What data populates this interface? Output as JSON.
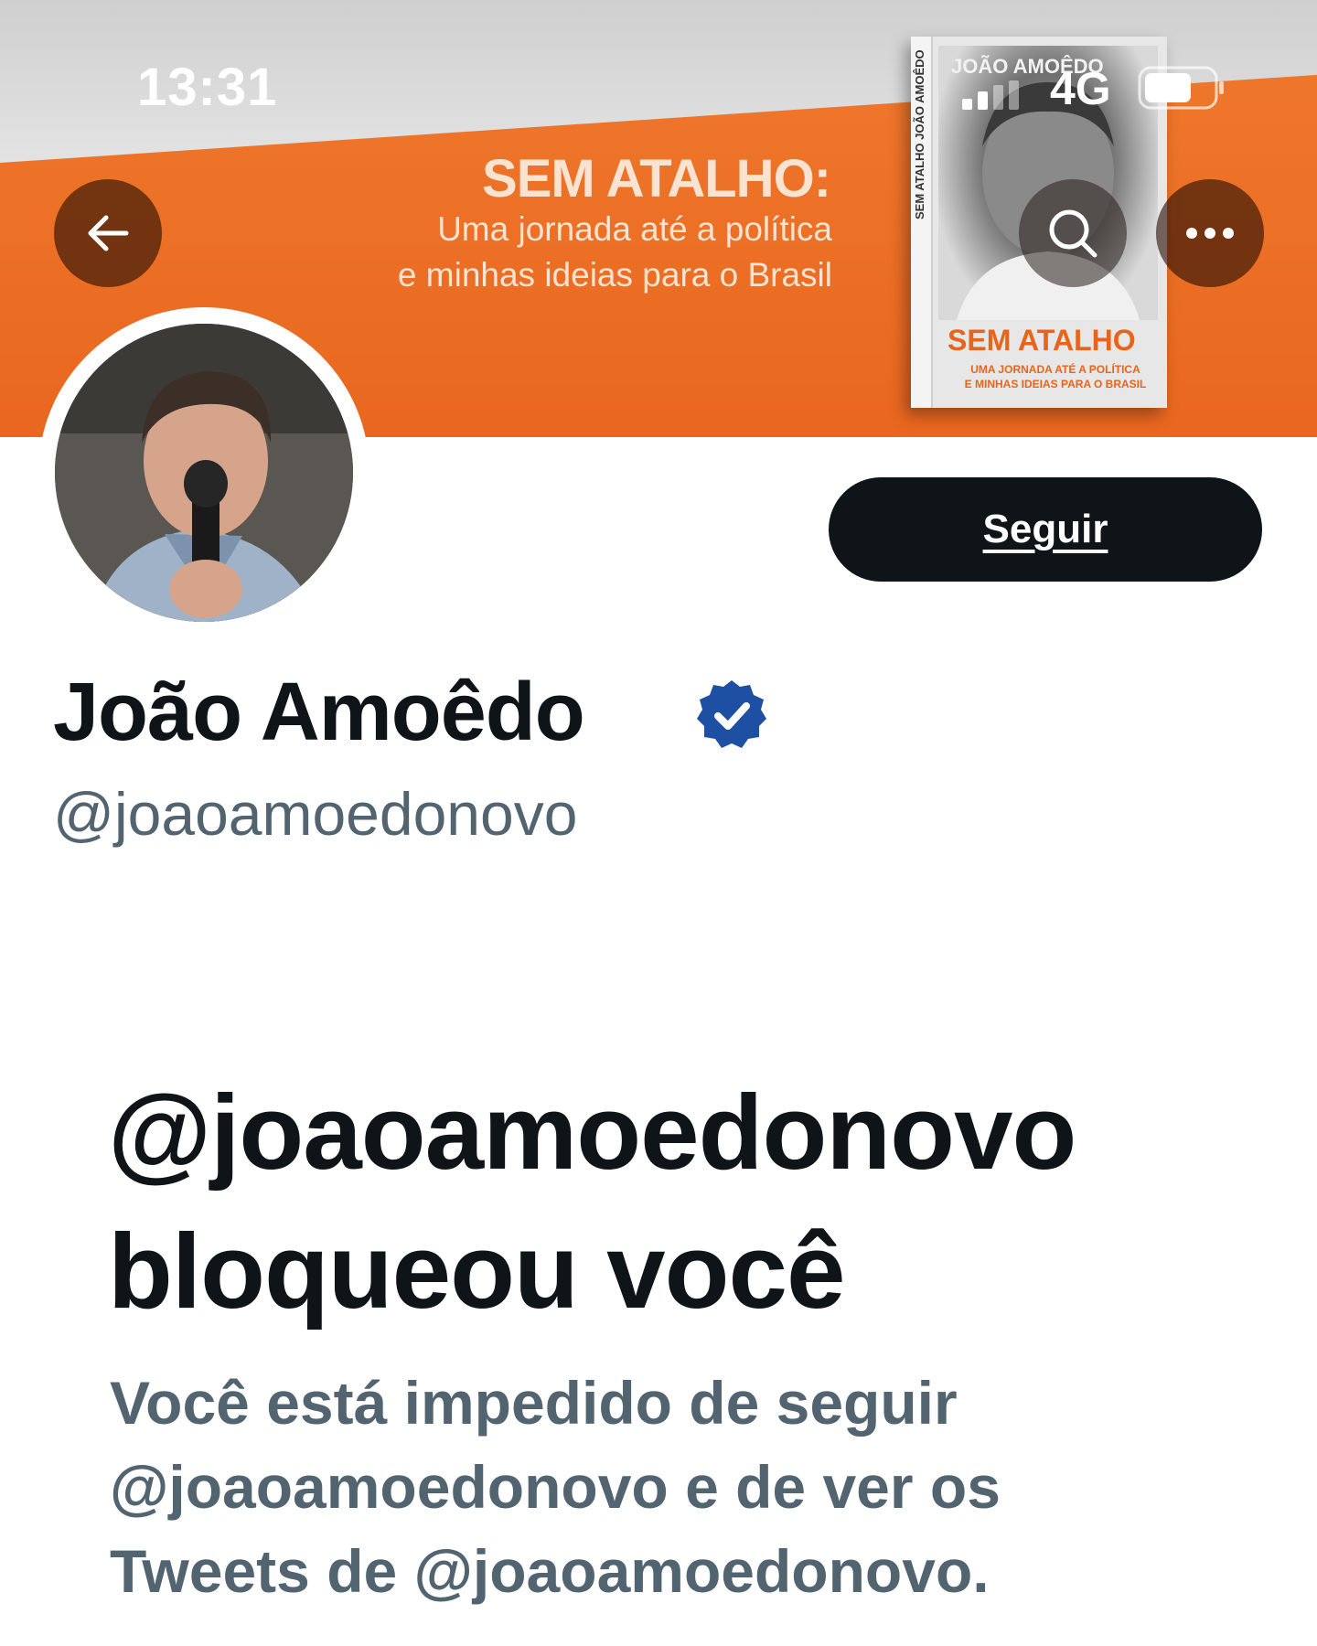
{
  "status_bar": {
    "time": "13:31",
    "network": "4G",
    "icons": [
      "signal-icon",
      "battery-icon"
    ]
  },
  "banner": {
    "headline": "SEM ATALHO:",
    "subtitle_line1": "Uma jornada até a política",
    "subtitle_line2": "e minhas ideias para o Brasil",
    "book": {
      "author": "JOÃO AMOÊDO",
      "spine": "SEM ATALHO   JOÃO AMOÊDO",
      "title": "SEM ATALHO",
      "subtitle_line1": "UMA JORNADA ATÉ A POLÍTICA",
      "subtitle_line2": "E MINHAS IDEIAS PARA O BRASIL"
    },
    "colors": {
      "orange": "#e9671f",
      "gray": "#d4d4d4"
    }
  },
  "header_actions": {
    "icons": [
      "back-arrow-icon",
      "search-icon",
      "more-icon"
    ]
  },
  "profile": {
    "display_name": "João Amoêdo",
    "handle": "@joaoamoedonovo",
    "follow_label": "Seguir",
    "verified": true,
    "verified_color": "#1d4fa3"
  },
  "blocked": {
    "title_line1": "@joaoamoedonovo",
    "title_line2": "bloqueou você",
    "message_line1": "Você está impedido de seguir",
    "message_line2": "@joaoamoedonovo e de ver os",
    "message_line3": "Tweets de @joaoamoedonovo."
  }
}
